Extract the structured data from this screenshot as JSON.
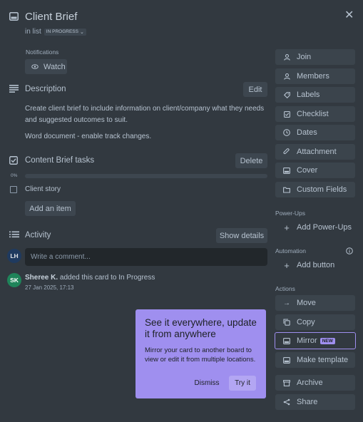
{
  "card": {
    "title": "Client Brief",
    "in_list_prefix": "in list",
    "list_name": "IN PROGRESS"
  },
  "notifications": {
    "label": "Notifications",
    "watch_label": "Watch"
  },
  "description": {
    "title": "Description",
    "edit_label": "Edit",
    "paragraph1": "Create client brief to include information on client/company what they needs and suggested outcomes to suit.",
    "paragraph2": "Word document - enable track changes."
  },
  "checklist": {
    "title": "Content Brief tasks",
    "delete_label": "Delete",
    "progress_text": "0%",
    "progress_value": 0,
    "items": [
      {
        "label": "Client story",
        "checked": false
      }
    ],
    "add_item_label": "Add an item"
  },
  "activity": {
    "title": "Activity",
    "show_details_label": "Show details",
    "comment_placeholder": "Write a comment...",
    "current_user_initials": "LH",
    "entries": [
      {
        "initials": "SK",
        "author": "Sheree K.",
        "action": "added this card to In Progress",
        "timestamp": "27 Jan 2025, 17:13"
      }
    ]
  },
  "sidebar": {
    "add_to_card": [
      {
        "label": "Join",
        "icon": "user-icon"
      },
      {
        "label": "Members",
        "icon": "user-icon"
      },
      {
        "label": "Labels",
        "icon": "tag-icon"
      },
      {
        "label": "Checklist",
        "icon": "checklist-icon"
      },
      {
        "label": "Dates",
        "icon": "clock-icon"
      },
      {
        "label": "Attachment",
        "icon": "paperclip-icon"
      },
      {
        "label": "Cover",
        "icon": "card-cover-icon"
      },
      {
        "label": "Custom Fields",
        "icon": "folder-icon"
      }
    ],
    "powerups_label": "Power-Ups",
    "add_powerups_label": "Add Power-Ups",
    "automation_label": "Automation",
    "add_button_label": "Add button",
    "actions_label": "Actions",
    "actions": [
      {
        "label": "Move",
        "icon": "arrow-right-icon"
      },
      {
        "label": "Copy",
        "icon": "copy-icon"
      },
      {
        "label": "Mirror",
        "icon": "mirror-icon",
        "badge": "NEW"
      },
      {
        "label": "Make template",
        "icon": "template-icon"
      },
      {
        "label": "Archive",
        "icon": "archive-icon"
      },
      {
        "label": "Share",
        "icon": "share-icon"
      }
    ]
  },
  "popover": {
    "title": "See it everywhere, update it from anywhere",
    "body": "Mirror your card to another board to view or edit it from multiple locations.",
    "dismiss_label": "Dismiss",
    "try_label": "Try it"
  },
  "colors": {
    "background": "#323940",
    "accent_purple": "#9f8fef",
    "avatar_lh": "#1f3a5f",
    "avatar_sk": "#1f845a"
  }
}
